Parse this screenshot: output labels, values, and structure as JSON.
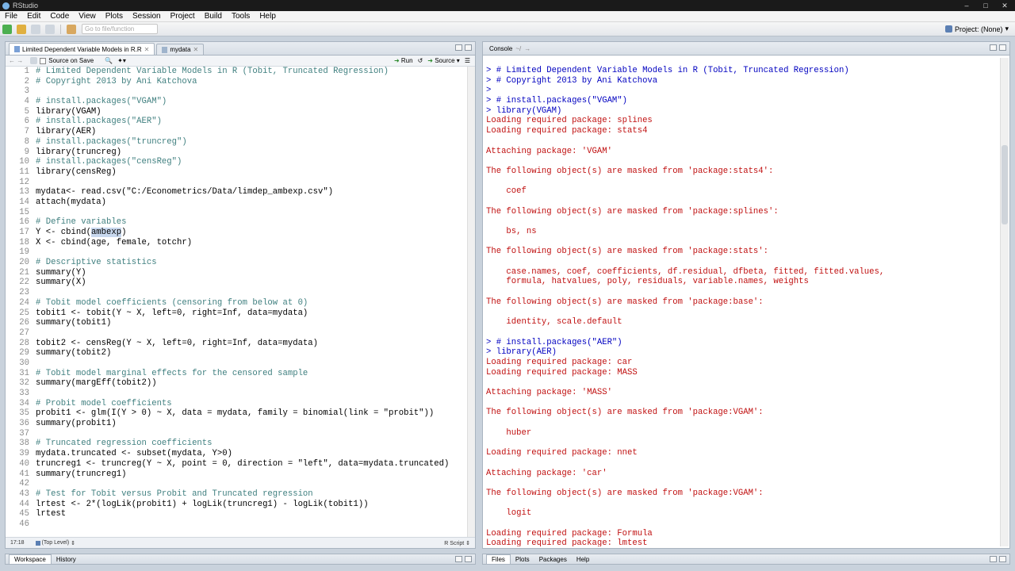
{
  "window": {
    "title": "RStudio"
  },
  "menu": [
    "File",
    "Edit",
    "Code",
    "View",
    "Plots",
    "Session",
    "Project",
    "Build",
    "Tools",
    "Help"
  ],
  "toolbar": {
    "goto_placeholder": "Go to file/function",
    "project_label": "Project: (None)"
  },
  "editor": {
    "tabs": [
      {
        "label": "Limited Dependent Variable Models in R.R"
      },
      {
        "label": "mydata"
      }
    ],
    "toolbar": {
      "source_on_save": "Source on Save",
      "run": "Run",
      "source": "Source"
    },
    "status": {
      "position": "17:18",
      "level": "(Top Level)",
      "file_type": "R Script"
    },
    "lines": [
      {
        "n": "1",
        "t": "# Limited Dependent Variable Models in R (Tobit, Truncated Regression)",
        "c": true
      },
      {
        "n": "2",
        "t": "# Copyright 2013 by Ani Katchova",
        "c": true
      },
      {
        "n": "3",
        "t": ""
      },
      {
        "n": "4",
        "t": "# install.packages(\"VGAM\")",
        "c": true
      },
      {
        "n": "5",
        "t": "library(VGAM)"
      },
      {
        "n": "6",
        "t": "# install.packages(\"AER\")",
        "c": true
      },
      {
        "n": "7",
        "t": "library(AER)"
      },
      {
        "n": "8",
        "t": "# install.packages(\"truncreg\")",
        "c": true
      },
      {
        "n": "9",
        "t": "library(truncreg)"
      },
      {
        "n": "10",
        "t": "# install.packages(\"censReg\")",
        "c": true
      },
      {
        "n": "11",
        "t": "library(censReg)"
      },
      {
        "n": "12",
        "t": ""
      },
      {
        "n": "13",
        "t": "mydata<- read.csv(\"C:/Econometrics/Data/limdep_ambexp.csv\")"
      },
      {
        "n": "14",
        "t": "attach(mydata)"
      },
      {
        "n": "15",
        "t": ""
      },
      {
        "n": "16",
        "t": "# Define variables",
        "c": true
      },
      {
        "n": "17",
        "t": "Y <- cbind(ambexp)",
        "sel": "ambexp"
      },
      {
        "n": "18",
        "t": "X <- cbind(age, female, totchr)"
      },
      {
        "n": "19",
        "t": ""
      },
      {
        "n": "20",
        "t": "# Descriptive statistics",
        "c": true
      },
      {
        "n": "21",
        "t": "summary(Y)"
      },
      {
        "n": "22",
        "t": "summary(X)"
      },
      {
        "n": "23",
        "t": ""
      },
      {
        "n": "24",
        "t": "# Tobit model coefficients (censoring from below at 0)",
        "c": true
      },
      {
        "n": "25",
        "t": "tobit1 <- tobit(Y ~ X, left=0, right=Inf, data=mydata)"
      },
      {
        "n": "26",
        "t": "summary(tobit1)"
      },
      {
        "n": "27",
        "t": ""
      },
      {
        "n": "28",
        "t": "tobit2 <- censReg(Y ~ X, left=0, right=Inf, data=mydata)"
      },
      {
        "n": "29",
        "t": "summary(tobit2)"
      },
      {
        "n": "30",
        "t": ""
      },
      {
        "n": "31",
        "t": "# Tobit model marginal effects for the censored sample",
        "c": true
      },
      {
        "n": "32",
        "t": "summary(margEff(tobit2))"
      },
      {
        "n": "33",
        "t": ""
      },
      {
        "n": "34",
        "t": "# Probit model coefficients",
        "c": true
      },
      {
        "n": "35",
        "t": "probit1 <- glm(I(Y > 0) ~ X, data = mydata, family = binomial(link = \"probit\"))"
      },
      {
        "n": "36",
        "t": "summary(probit1)"
      },
      {
        "n": "37",
        "t": ""
      },
      {
        "n": "38",
        "t": "# Truncated regression coefficients",
        "c": true
      },
      {
        "n": "39",
        "t": "mydata.truncated <- subset(mydata, Y>0)"
      },
      {
        "n": "40",
        "t": "truncreg1 <- truncreg(Y ~ X, point = 0, direction = \"left\", data=mydata.truncated)"
      },
      {
        "n": "41",
        "t": "summary(truncreg1)"
      },
      {
        "n": "42",
        "t": ""
      },
      {
        "n": "43",
        "t": "# Test for Tobit versus Probit and Truncated regression",
        "c": true
      },
      {
        "n": "44",
        "t": "lrtest <- 2*(logLik(probit1) + logLik(truncreg1) - logLik(tobit1))"
      },
      {
        "n": "45",
        "t": "lrtest"
      },
      {
        "n": "46",
        "t": ""
      }
    ]
  },
  "console": {
    "title": "Console",
    "subtitle": "~/",
    "lines": [
      {
        "k": "in",
        "t": "> # Limited Dependent Variable Models in R (Tobit, Truncated Regression)"
      },
      {
        "k": "in",
        "t": "> # Copyright 2013 by Ani Katchova"
      },
      {
        "k": "in",
        "t": ">"
      },
      {
        "k": "in",
        "t": "> # install.packages(\"VGAM\")"
      },
      {
        "k": "in",
        "t": "> library(VGAM)"
      },
      {
        "k": "out",
        "t": "Loading required package: splines"
      },
      {
        "k": "out",
        "t": "Loading required package: stats4"
      },
      {
        "k": "out",
        "t": ""
      },
      {
        "k": "out",
        "t": "Attaching package: 'VGAM'"
      },
      {
        "k": "out",
        "t": ""
      },
      {
        "k": "out",
        "t": "The following object(s) are masked from 'package:stats4':"
      },
      {
        "k": "out",
        "t": ""
      },
      {
        "k": "out",
        "t": "    coef"
      },
      {
        "k": "out",
        "t": ""
      },
      {
        "k": "out",
        "t": "The following object(s) are masked from 'package:splines':"
      },
      {
        "k": "out",
        "t": ""
      },
      {
        "k": "out",
        "t": "    bs, ns"
      },
      {
        "k": "out",
        "t": ""
      },
      {
        "k": "out",
        "t": "The following object(s) are masked from 'package:stats':"
      },
      {
        "k": "out",
        "t": ""
      },
      {
        "k": "out",
        "t": "    case.names, coef, coefficients, df.residual, dfbeta, fitted, fitted.values,"
      },
      {
        "k": "out",
        "t": "    formula, hatvalues, poly, residuals, variable.names, weights"
      },
      {
        "k": "out",
        "t": ""
      },
      {
        "k": "out",
        "t": "The following object(s) are masked from 'package:base':"
      },
      {
        "k": "out",
        "t": ""
      },
      {
        "k": "out",
        "t": "    identity, scale.default"
      },
      {
        "k": "out",
        "t": ""
      },
      {
        "k": "in",
        "t": "> # install.packages(\"AER\")"
      },
      {
        "k": "in",
        "t": "> library(AER)"
      },
      {
        "k": "out",
        "t": "Loading required package: car"
      },
      {
        "k": "out",
        "t": "Loading required package: MASS"
      },
      {
        "k": "out",
        "t": ""
      },
      {
        "k": "out",
        "t": "Attaching package: 'MASS'"
      },
      {
        "k": "out",
        "t": ""
      },
      {
        "k": "out",
        "t": "The following object(s) are masked from 'package:VGAM':"
      },
      {
        "k": "out",
        "t": ""
      },
      {
        "k": "out",
        "t": "    huber"
      },
      {
        "k": "out",
        "t": ""
      },
      {
        "k": "out",
        "t": "Loading required package: nnet"
      },
      {
        "k": "out",
        "t": ""
      },
      {
        "k": "out",
        "t": "Attaching package: 'car'"
      },
      {
        "k": "out",
        "t": ""
      },
      {
        "k": "out",
        "t": "The following object(s) are masked from 'package:VGAM':"
      },
      {
        "k": "out",
        "t": ""
      },
      {
        "k": "out",
        "t": "    logit"
      },
      {
        "k": "out",
        "t": ""
      },
      {
        "k": "out",
        "t": "Loading required package: Formula"
      },
      {
        "k": "out",
        "t": "Loading required package: lmtest"
      }
    ]
  },
  "bottom_left_tabs": [
    "Workspace",
    "History"
  ],
  "bottom_right_tabs": [
    "Files",
    "Plots",
    "Packages",
    "Help"
  ],
  "colors": {
    "comment": "#3f7f7f",
    "console_input": "#0000c0",
    "console_output": "#c01010",
    "selection": "#c8d8ee"
  }
}
